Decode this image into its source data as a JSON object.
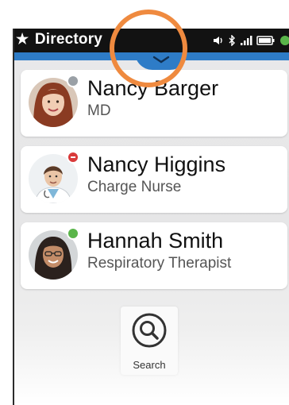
{
  "header": {
    "title": "Directory",
    "star_icon": "star-icon",
    "status_icons": [
      "volume-icon",
      "bluetooth-icon",
      "signal-icon",
      "battery-icon",
      "status-dot-icon"
    ]
  },
  "pull_tab": {
    "icon": "chevron-down-icon"
  },
  "contacts": [
    {
      "name": "Nancy Barger",
      "role": "MD",
      "status": "away",
      "status_color": "#9aa0a6"
    },
    {
      "name": "Nancy Higgins",
      "role": "Charge Nurse",
      "status": "busy",
      "status_color": "#d93a3a"
    },
    {
      "name": "Hannah Smith",
      "role": "Respiratory Therapist",
      "status": "available",
      "status_color": "#5ab54a"
    }
  ],
  "search": {
    "label": "Search",
    "icon": "search-icon"
  },
  "colors": {
    "accent": "#2e7cc7",
    "highlight": "#ef8a3f",
    "statusbar": "#121212"
  }
}
